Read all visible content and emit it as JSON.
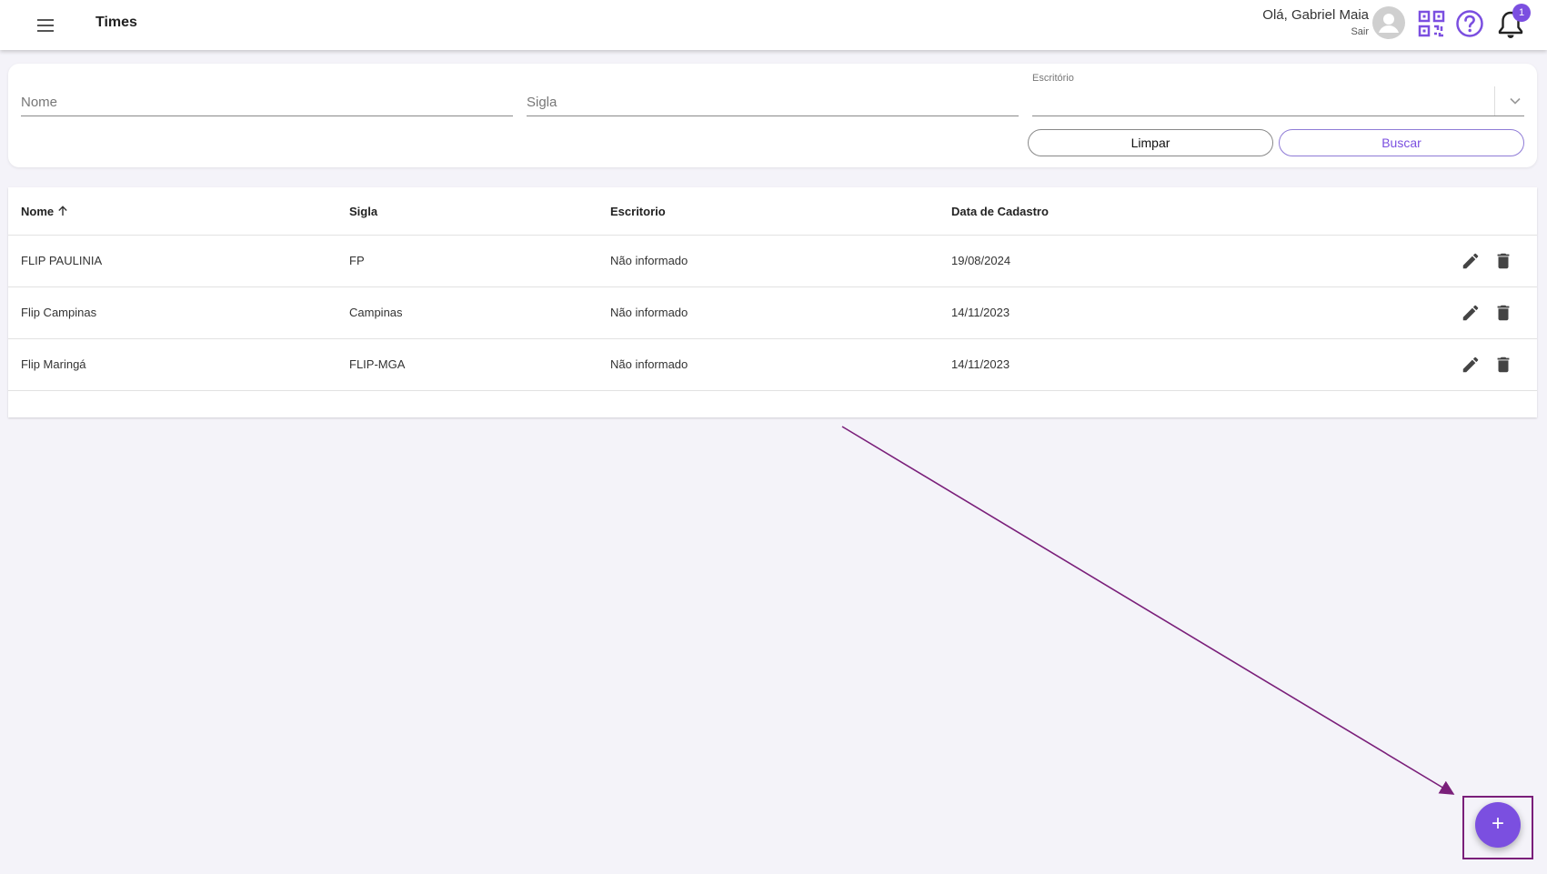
{
  "header": {
    "title": "Times",
    "greeting": "Olá, Gabriel Maia",
    "logout": "Sair",
    "notification_count": "1",
    "icons": [
      "menu-icon",
      "avatar-icon",
      "qr-code-icon",
      "help-icon",
      "bell-icon"
    ],
    "accent_color": "#7b4fe0"
  },
  "filters": {
    "nome_placeholder": "Nome",
    "sigla_placeholder": "Sigla",
    "escritorio_label": "Escritório",
    "escritorio_value": "",
    "clear_label": "Limpar",
    "search_label": "Buscar"
  },
  "table": {
    "columns": [
      "Nome",
      "Sigla",
      "Escritorio",
      "Data de Cadastro"
    ],
    "sorted_column": "Nome",
    "sort_direction": "asc",
    "rows": [
      [
        "FLIP PAULINIA",
        "FP",
        "Não informado",
        "19/08/2024"
      ],
      [
        "Flip Campinas",
        "Campinas",
        "Não informado",
        "14/11/2023"
      ],
      [
        "Flip Maringá",
        "FLIP-MGA",
        "Não informado",
        "14/11/2023"
      ]
    ]
  },
  "fab": {
    "label": "+"
  },
  "annotation": {
    "color": "#7a1f7a"
  }
}
